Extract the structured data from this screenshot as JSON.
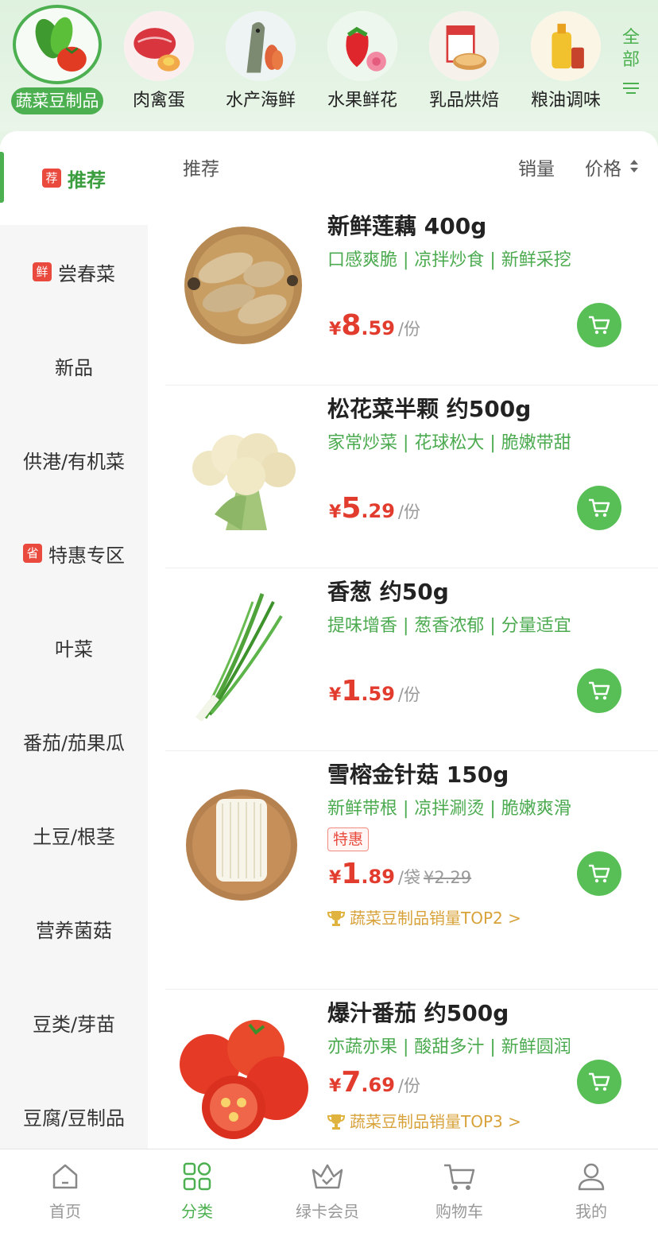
{
  "categories": [
    {
      "label": "蔬菜豆制品",
      "icon": "vegetables-icon",
      "active": true
    },
    {
      "label": "肉禽蛋",
      "icon": "meat-icon"
    },
    {
      "label": "水产海鲜",
      "icon": "fish-icon"
    },
    {
      "label": "水果鲜花",
      "icon": "strawberry-icon"
    },
    {
      "label": "乳品烘焙",
      "icon": "milk-bread-icon"
    },
    {
      "label": "粮油调味",
      "icon": "oil-icon"
    }
  ],
  "all_button": {
    "label_top": "全",
    "label_bottom": "部"
  },
  "sidebar": {
    "items": [
      {
        "label": "推荐",
        "tag": "荐"
      },
      {
        "label": "尝春菜",
        "tag": "鲜"
      },
      {
        "label": "新品"
      },
      {
        "label": "供港/有机菜"
      },
      {
        "label": "特惠专区",
        "tag": "省"
      },
      {
        "label": "叶菜"
      },
      {
        "label": "番茄/茄果瓜"
      },
      {
        "label": "土豆/根茎"
      },
      {
        "label": "营养菌菇"
      },
      {
        "label": "豆类/芽苗"
      },
      {
        "label": "豆腐/豆制品"
      }
    ]
  },
  "sort": {
    "recommend": "推荐",
    "sales": "销量",
    "price": "价格"
  },
  "products": [
    {
      "name": "新鲜莲藕 400g",
      "desc": "口感爽脆 | 凉拌炒食 | 新鲜采挖",
      "yen": "¥",
      "price_int": "8",
      "price_dec": ".59",
      "unit": "/份",
      "icon": "lotus-root-icon"
    },
    {
      "name": "松花菜半颗 约500g",
      "desc": "家常炒菜 | 花球松大 | 脆嫩带甜",
      "yen": "¥",
      "price_int": "5",
      "price_dec": ".29",
      "unit": "/份",
      "icon": "cauliflower-icon"
    },
    {
      "name": "香葱 约50g",
      "desc": "提味增香 | 葱香浓郁 | 分量适宜",
      "yen": "¥",
      "price_int": "1",
      "price_dec": ".59",
      "unit": "/份",
      "icon": "scallion-icon"
    },
    {
      "name": "雪榕金针菇 150g",
      "desc": "新鲜带根 | 凉拌涮烫 | 脆嫩爽滑",
      "badge": "特惠",
      "yen": "¥",
      "price_int": "1",
      "price_dec": ".89",
      "unit": "/袋",
      "orig": "¥2.29",
      "rank": "蔬菜豆制品销量TOP2 >",
      "icon": "enoki-icon"
    },
    {
      "name": "爆汁番茄 约500g",
      "desc": "亦蔬亦果 | 酸甜多汁 | 新鲜圆润",
      "yen": "¥",
      "price_int": "7",
      "price_dec": ".69",
      "unit": "/份",
      "rank": "蔬菜豆制品销量TOP3 >",
      "icon": "tomato-icon"
    }
  ],
  "tabs": [
    {
      "label": "首页",
      "icon": "home-icon"
    },
    {
      "label": "分类",
      "icon": "category-icon",
      "active": true
    },
    {
      "label": "绿卡会员",
      "icon": "membership-crown-icon"
    },
    {
      "label": "购物车",
      "icon": "cart-icon"
    },
    {
      "label": "我的",
      "icon": "profile-icon"
    }
  ],
  "colors": {
    "brand": "#4cb050",
    "price": "#e23c2e",
    "tag_red": "#e94a3d",
    "rank_gold": "#d8a23a"
  }
}
